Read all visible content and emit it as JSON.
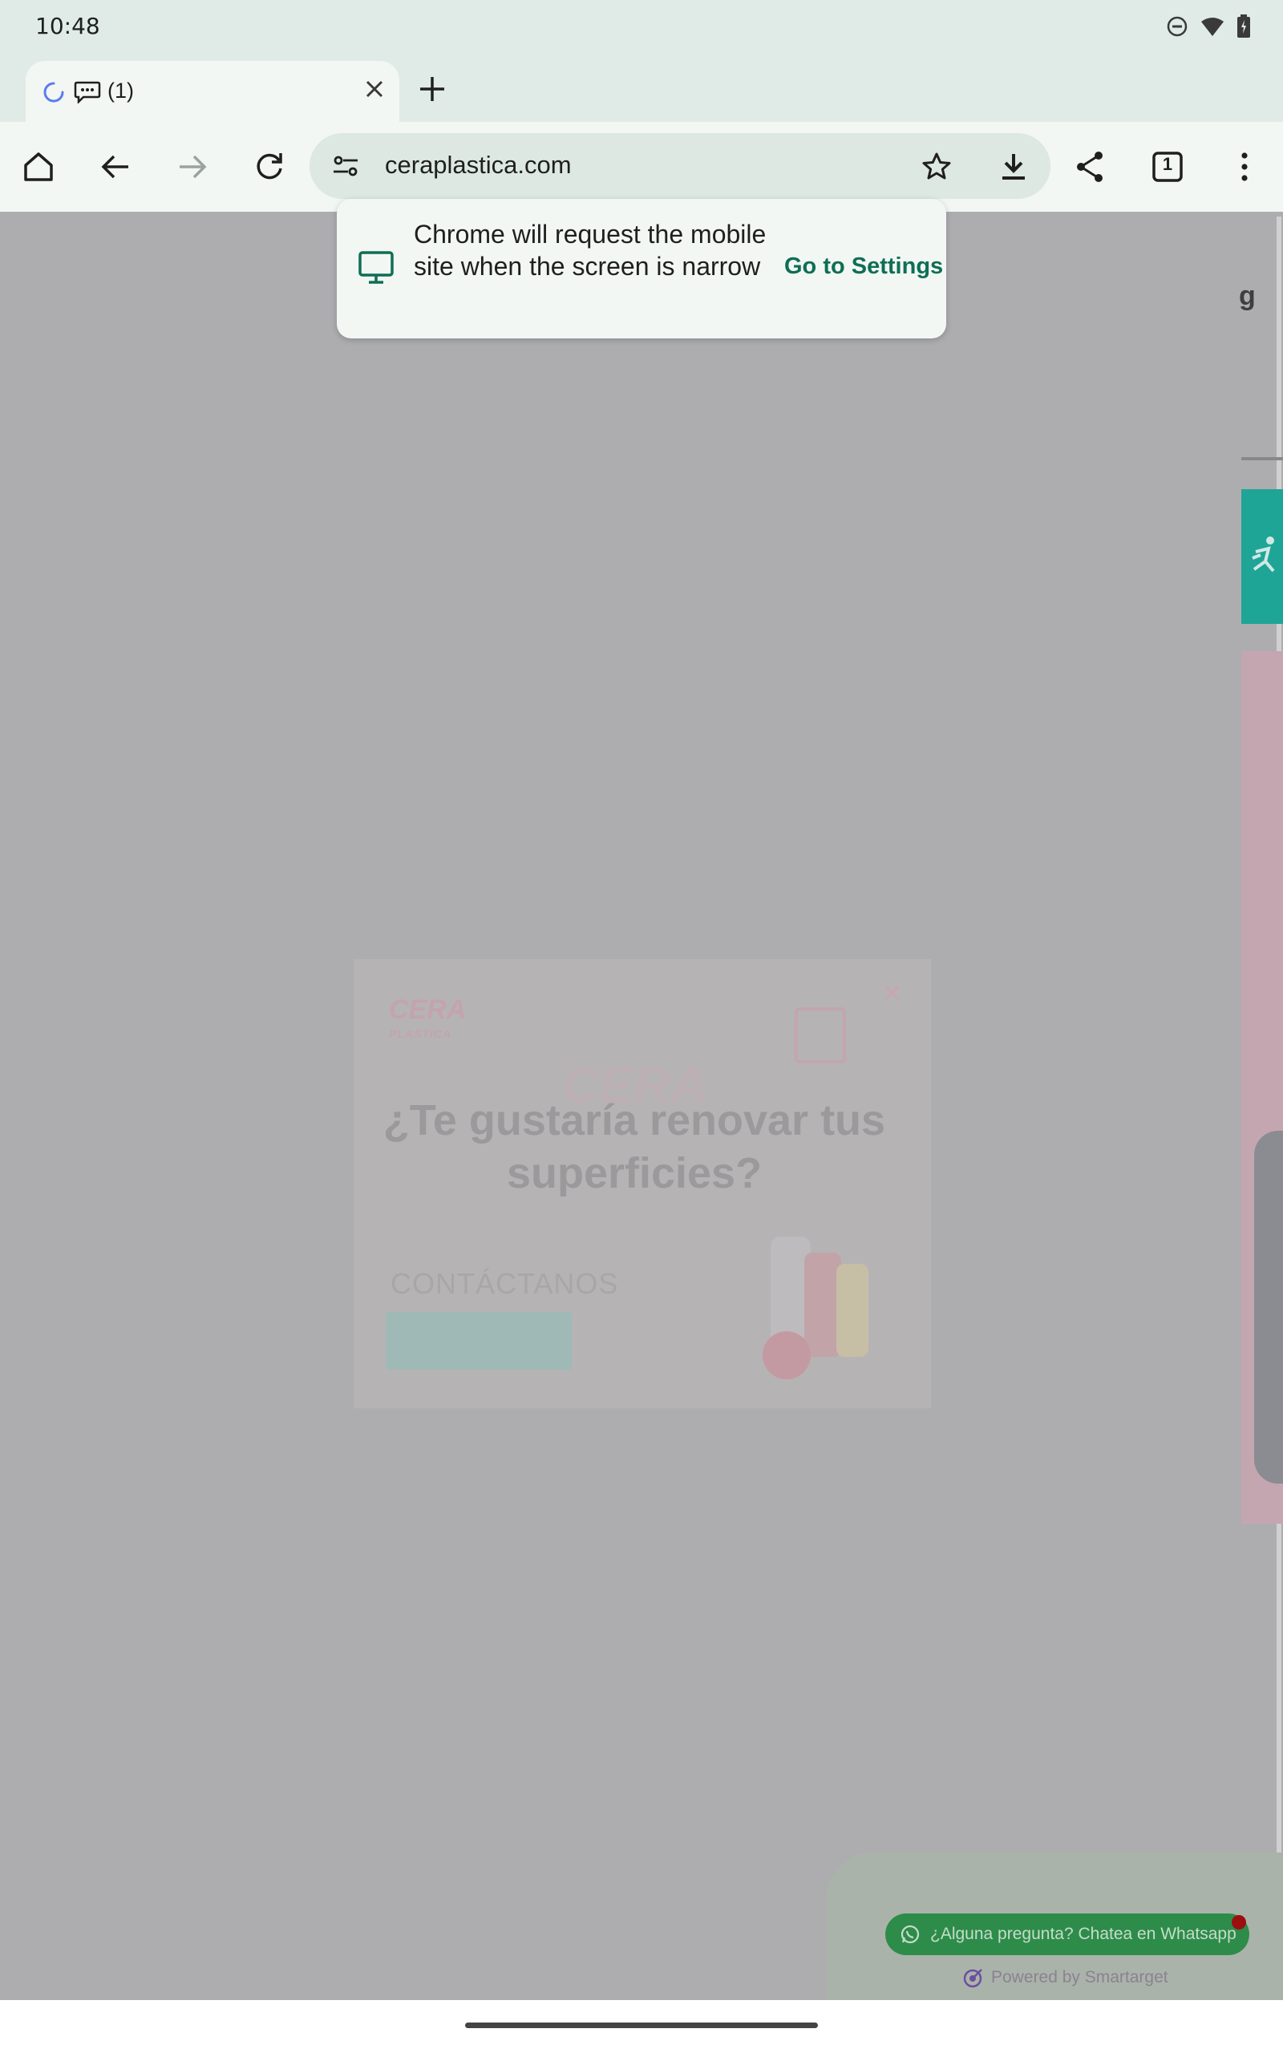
{
  "status_bar": {
    "time": "10:48",
    "icons": [
      "do-not-disturb-icon",
      "wifi-icon",
      "battery-icon"
    ]
  },
  "tab": {
    "title": "(1)",
    "icons": [
      "loading-spinner-icon",
      "chat-bubble-icon",
      "close-icon"
    ]
  },
  "toolbar": {
    "url": "ceraplastica.com",
    "tab_count": "1"
  },
  "bubble": {
    "message": "Chrome will request the mobile site when the screen is narrow",
    "link": "Go to Settings"
  },
  "page": {
    "partial_letter": "g",
    "popup": {
      "logo_main": "CERA",
      "logo_sub": "PLASTICA",
      "watermark": "CERA",
      "heading": "¿Te gustaría renovar tus superficies?",
      "contact": "CONTÁCTANOS",
      "close": "×"
    },
    "whatsapp": {
      "label": "¿Alguna pregunta? Chatea en Whatsapp",
      "powered": "Powered by Smartarget"
    }
  },
  "colors": {
    "chrome_bg": "#e0ebe7",
    "toolbar_bg": "#f2f7f4",
    "omnibox_bg": "#dde8e3",
    "link_green": "#0f6e54",
    "page_overlay": "#adadb0",
    "whatsapp_green": "#2d8c4a"
  }
}
